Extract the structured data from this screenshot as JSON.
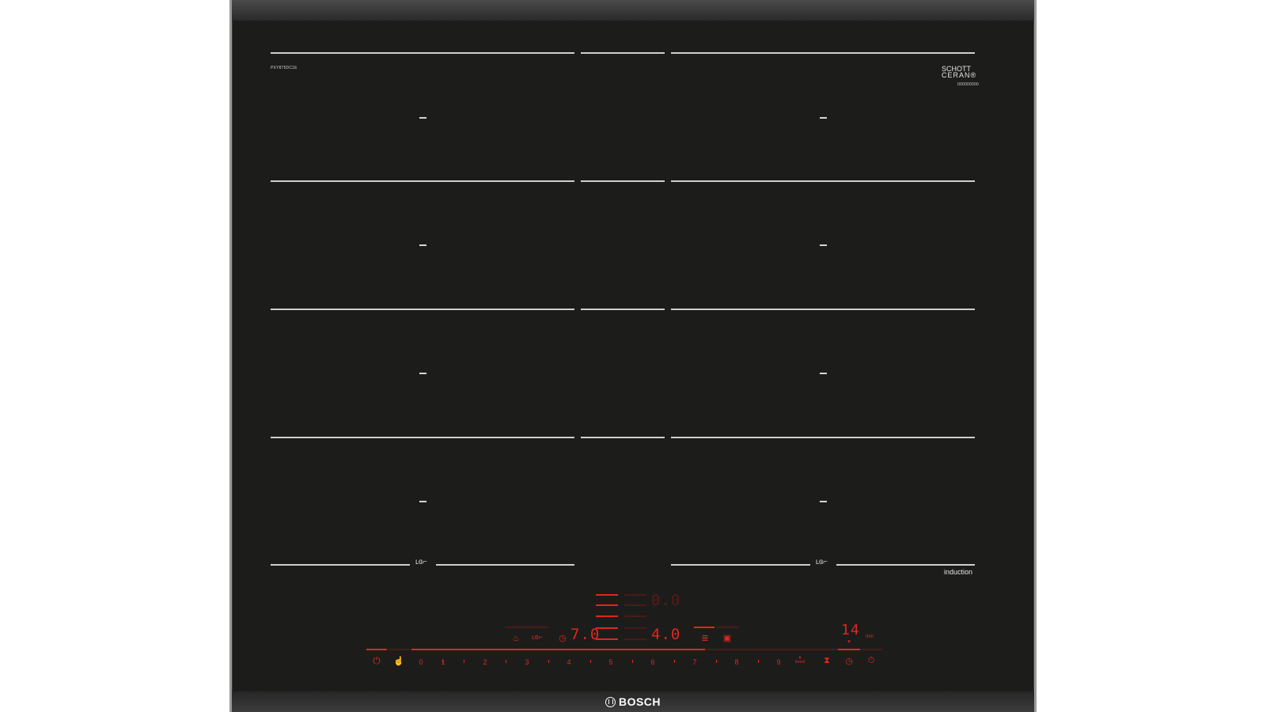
{
  "product": {
    "model_code": "PXY875DC1E",
    "glass_brand_line1": "SCHOTT",
    "glass_brand_line2": "CERAN®",
    "glass_code": "000000000",
    "induction_label": "induction",
    "brand": "BOSCH"
  },
  "zones": {
    "flex_symbol_left": "ʟɞ⌐",
    "flex_symbol_right": "ʟɞ⌐"
  },
  "display": {
    "upper_readout": "0.0",
    "left_readout": "7.0",
    "right_readout": "4.0",
    "timer_readout": "14",
    "timer_unit": "min"
  },
  "control_panel": {
    "power_icon": "power-icon",
    "wipe_protection_icon": "wipe-protection-icon",
    "keep_warm_icon": "keep-warm-icon",
    "frying_sensor_icon": "frying-sensor-icon",
    "clock_icon": "clock-icon",
    "menu_icon": "menu-icon",
    "settings_icon": "settings-icon",
    "hourglass_icon": "hourglass-icon",
    "timer_icon": "timer-icon",
    "stopwatch_icon": "stopwatch-icon",
    "slider_labels": [
      "0",
      "1",
      "2",
      "3",
      "4",
      "5",
      "6",
      "7",
      "8",
      "9"
    ],
    "boost_label": "boost"
  },
  "colors": {
    "glass": "#1c1d1b",
    "accent_red": "#e0261d",
    "lines": "#cfcfcf"
  }
}
